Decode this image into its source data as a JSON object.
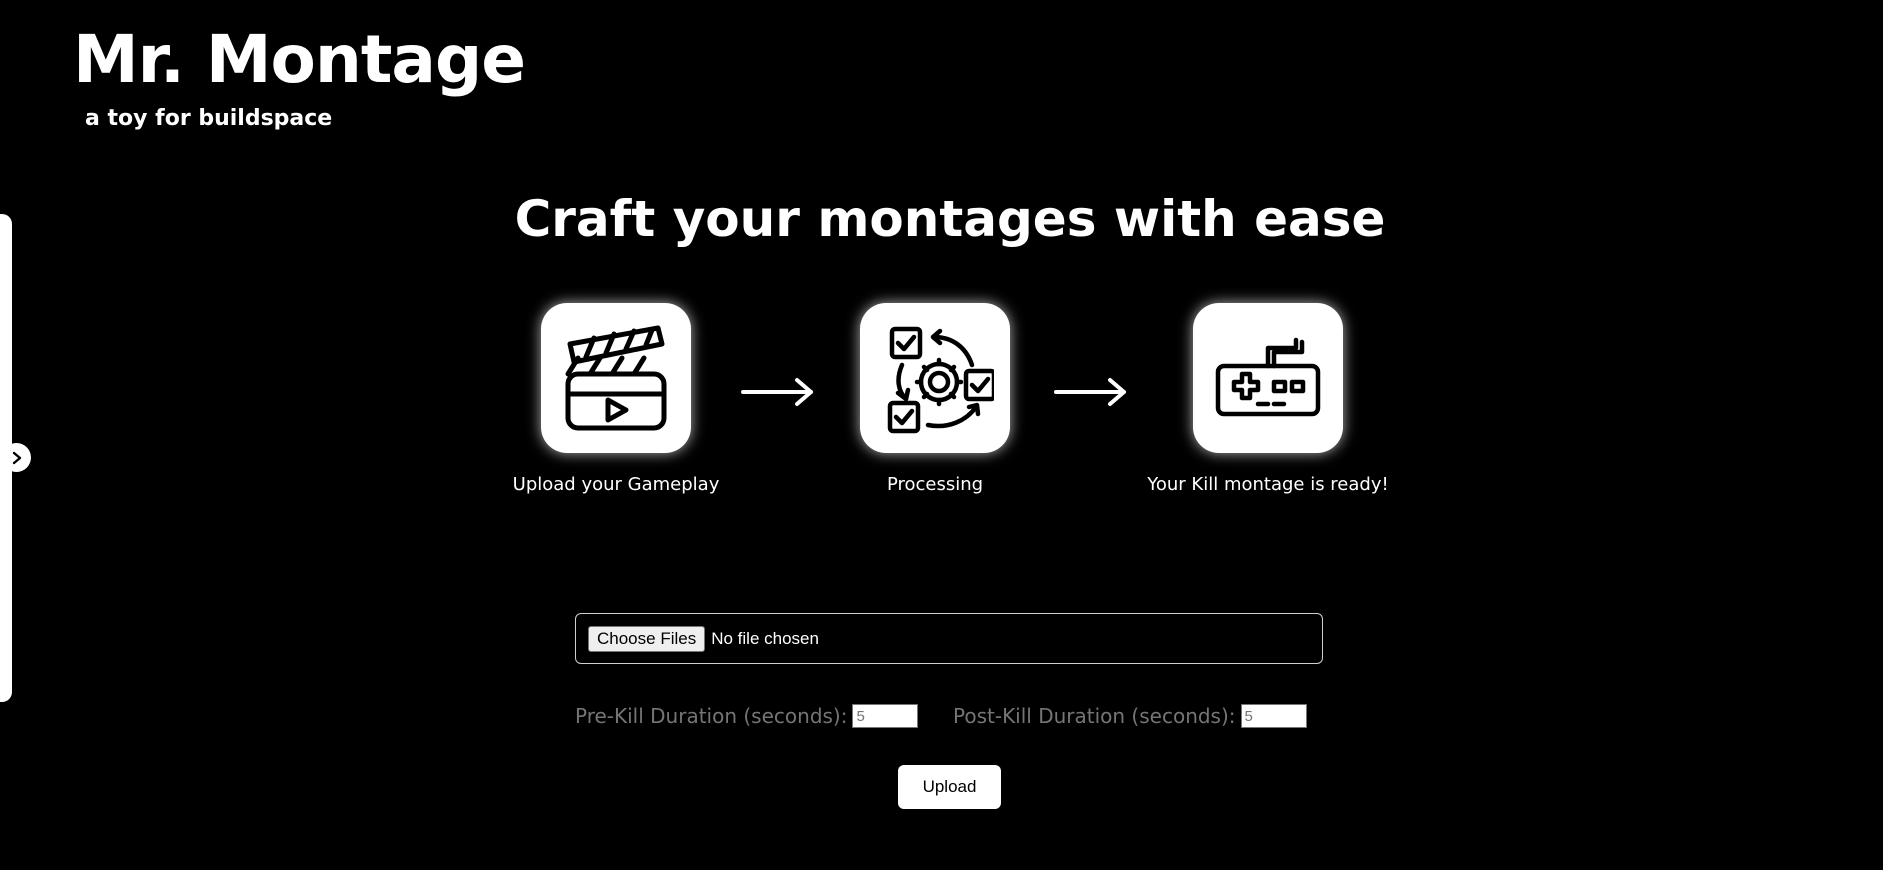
{
  "brand": {
    "title": "Mr. Montage",
    "subtitle": "a toy for buildspace"
  },
  "hero": {
    "title": "Craft your montages with ease"
  },
  "steps": [
    {
      "label": "Upload your Gameplay",
      "icon": "clapperboard-icon"
    },
    {
      "label": "Processing",
      "icon": "processing-gear-icon"
    },
    {
      "label": "Your Kill montage is ready!",
      "icon": "gamepad-icon"
    }
  ],
  "upload_form": {
    "choose_files_label": "Choose Files",
    "file_status": "No file chosen",
    "pre_kill_label": "Pre-Kill Duration (seconds):",
    "pre_kill_placeholder": "5",
    "post_kill_label": "Post-Kill Duration (seconds):",
    "post_kill_placeholder": "5",
    "upload_label": "Upload"
  },
  "colors": {
    "background": "#000000",
    "text": "#ffffff",
    "muted_text": "#757575"
  }
}
